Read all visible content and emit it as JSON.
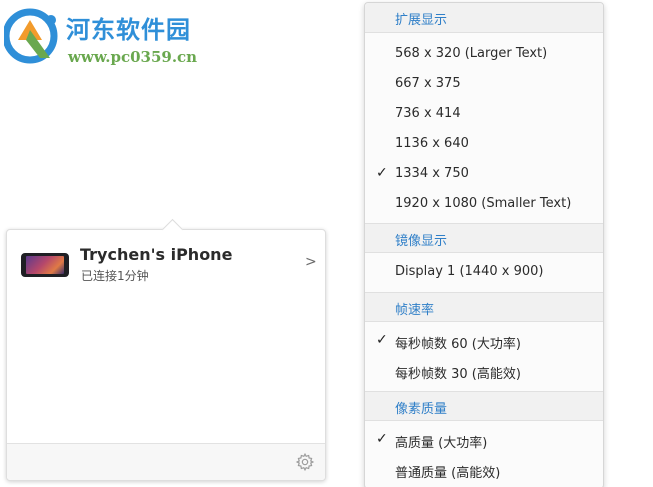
{
  "watermark": {
    "title": "河东软件园",
    "url": "www.pc0359.cn"
  },
  "device_popover": {
    "device_name": "Trychen's iPhone",
    "status": "已连接1分钟",
    "chevron": ">"
  },
  "menu": {
    "sections": [
      {
        "title": "扩展显示",
        "items": [
          {
            "label": "568 x 320 (Larger Text)",
            "checked": false
          },
          {
            "label": "667 x 375",
            "checked": false
          },
          {
            "label": "736 x 414",
            "checked": false
          },
          {
            "label": "1136 x 640",
            "checked": false
          },
          {
            "label": "1334 x 750",
            "checked": true
          },
          {
            "label": "1920 x 1080 (Smaller Text)",
            "checked": false
          }
        ]
      },
      {
        "title": "镜像显示",
        "items": [
          {
            "label": "Display 1 (1440 x 900)",
            "checked": false
          }
        ]
      },
      {
        "title": "帧速率",
        "items": [
          {
            "label": "每秒帧数 60 (大功率)",
            "checked": true
          },
          {
            "label": "每秒帧数 30 (高能效)",
            "checked": false
          }
        ]
      },
      {
        "title": "像素质量",
        "items": [
          {
            "label": "高质量 (大功率)",
            "checked": true
          },
          {
            "label": "普通质量 (高能效)",
            "checked": false
          }
        ]
      }
    ],
    "check_glyph": "✓"
  }
}
